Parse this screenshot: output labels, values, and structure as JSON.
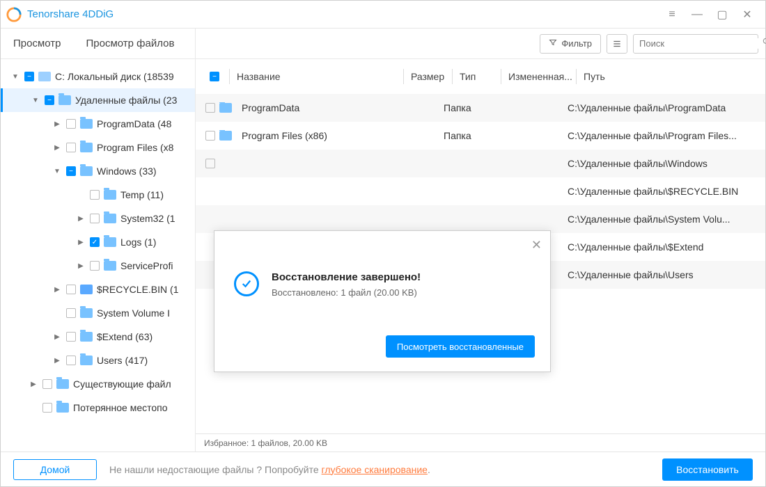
{
  "app": {
    "title": "Tenorshare 4DDiG"
  },
  "tabs": {
    "view": "Просмотр",
    "files": "Просмотр файлов"
  },
  "toolbar": {
    "filter": "Фильтр",
    "search_placeholder": "Поиск"
  },
  "tree": {
    "root": "C: Локальный диск (18539",
    "deleted": "Удаленные файлы (23",
    "programdata": "ProgramData (48",
    "programfiles": "Program Files (x8",
    "windows": "Windows (33)",
    "temp": "Temp (11)",
    "system32": "System32 (1",
    "logs": "Logs (1)",
    "serviceprofi": "ServiceProfi",
    "recycle": "$RECYCLE.BIN (1",
    "sysvol": "System Volume I",
    "extend": "$Extend (63)",
    "users": "Users (417)",
    "existing": "Существующие файл",
    "lost": "Потерянное местопо"
  },
  "columns": {
    "name": "Название",
    "size": "Размер",
    "type": "Тип",
    "modified": "Измененная...",
    "path": "Путь"
  },
  "rows": [
    {
      "name": "ProgramData",
      "type": "Папка",
      "path": "C:\\Удаленные файлы\\ProgramData"
    },
    {
      "name": "Program Files (x86)",
      "type": "Папка",
      "path": "C:\\Удаленные файлы\\Program Files..."
    },
    {
      "name": "",
      "type": "",
      "path": "C:\\Удаленные файлы\\Windows"
    },
    {
      "name": "",
      "type": "",
      "path": "C:\\Удаленные файлы\\$RECYCLE.BIN"
    },
    {
      "name": "",
      "type": "",
      "path": "C:\\Удаленные файлы\\System Volu..."
    },
    {
      "name": "",
      "type": "",
      "path": "C:\\Удаленные файлы\\$Extend"
    },
    {
      "name": "",
      "type": "",
      "path": "C:\\Удаленные файлы\\Users"
    }
  ],
  "status": "Избранное: 1 файлов, 20.00 KB",
  "footer": {
    "home": "Домой",
    "hint_prefix": "Не нашли недостающие файлы ? Попробуйте ",
    "hint_link": "глубокое сканирование",
    "hint_suffix": ".",
    "recover": "Восстановить"
  },
  "modal": {
    "title": "Восстановление завершено!",
    "detail": "Восстановлено: 1 файл (20.00 KB)",
    "button": "Посмотреть восстановленные"
  }
}
